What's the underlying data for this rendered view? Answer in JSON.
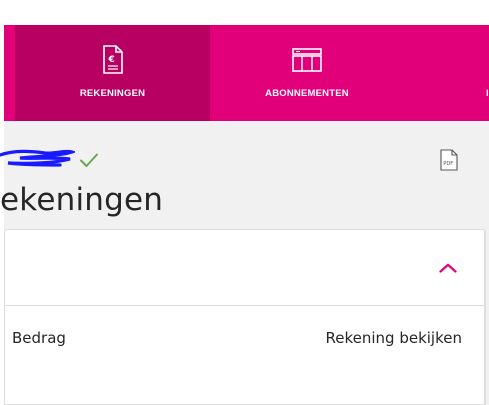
{
  "nav": {
    "items": [
      {
        "label": "REKENINGEN",
        "icon": "invoice-euro-icon",
        "active": true
      },
      {
        "label": "ABONNEMENTEN",
        "icon": "subscription-icon",
        "active": false
      },
      {
        "label": "I",
        "icon": "",
        "active": false
      }
    ]
  },
  "page": {
    "title": "ekeningen"
  },
  "invoices_panel": {
    "collapse_icon": "chevron-up-icon",
    "columns": {
      "amount": "Bedrag",
      "view": "Rekening bekijken"
    },
    "rows": [
      {
        "status_icon": "check-icon",
        "download_icon": "pdf-icon",
        "pdf_label": "PDF"
      }
    ]
  },
  "colors": {
    "brand_magenta": "#e2007a",
    "active_tab": "#b80063",
    "check_green": "#6aa84f",
    "redaction_blue": "#1a1aff"
  }
}
